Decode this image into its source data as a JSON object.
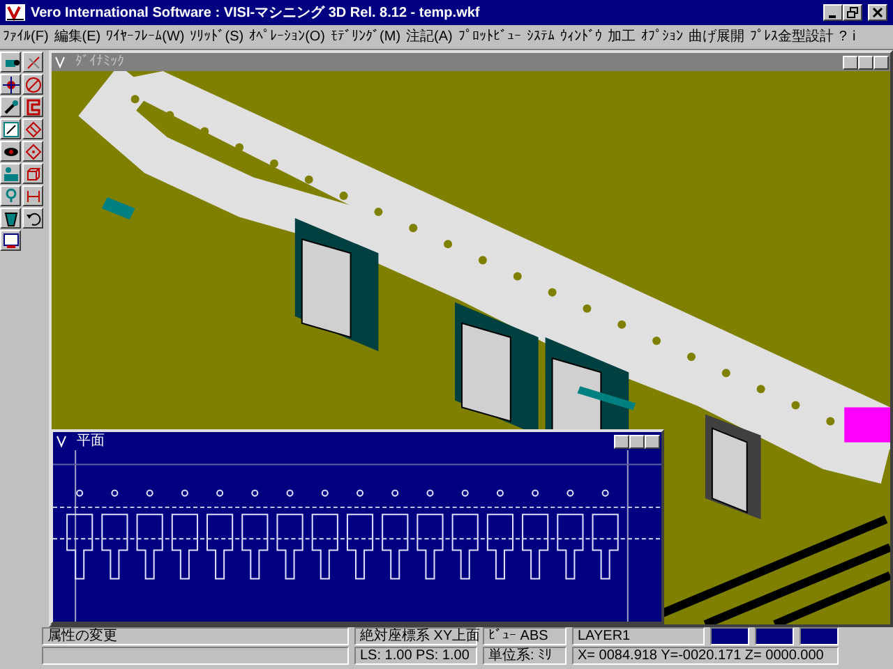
{
  "window": {
    "title": "Vero International Software : VISI-マシニング 3D Rel. 8.12 - temp.wkf"
  },
  "menu": [
    "ﾌｧｲﾙ(F)",
    "編集(E)",
    "ﾜｲﾔｰﾌﾚｰﾑ(W)",
    "ｿﾘｯﾄﾞ(S)",
    "ｵﾍﾟﾚｰｼｮﾝ(O)",
    "ﾓﾃﾞﾘﾝｸﾞ(M)",
    "注記(A)",
    "ﾌﾟﾛｯﾄﾋﾞｭｰ",
    "ｼｽﾃﾑ",
    "ｳｨﾝﾄﾞｳ",
    "加工",
    "ｵﾌﾟｼｮﾝ",
    "曲げ展開",
    "ﾌﾟﾚｽ金型設計",
    "?",
    "i"
  ],
  "views": [
    {
      "title": "ﾀﾞｲﾅﾐｯｸ",
      "active": false
    },
    {
      "title": "平面",
      "active": true
    }
  ],
  "status_bar": {
    "message": "属性の変更",
    "coord_system": "絶対座標系  XY上面",
    "view": "ﾋﾞｭｰ ABS",
    "layer": "LAYER1",
    "scale": "LS: 1.00 PS: 1.00",
    "units": "単位系: ﾐﾘ",
    "coordinates": "X= 0084.918 Y=-0020.171 Z= 0000.000"
  }
}
